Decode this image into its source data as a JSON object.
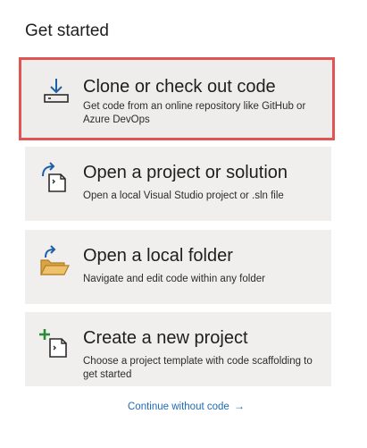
{
  "heading": "Get started",
  "cards": [
    {
      "title": "Clone or check out code",
      "description": "Get code from an online repository like GitHub or Azure DevOps",
      "icon": "download-clone-icon"
    },
    {
      "title": "Open a project or solution",
      "description": "Open a local Visual Studio project or .sln file",
      "icon": "open-project-icon"
    },
    {
      "title": "Open a local folder",
      "description": "Navigate and edit code within any folder",
      "icon": "open-folder-icon"
    },
    {
      "title": "Create a new project",
      "description": "Choose a project template with code scaffolding to get started",
      "icon": "new-project-icon"
    }
  ],
  "continue_link": {
    "label": "Continue without code",
    "arrow": "→"
  },
  "colors": {
    "highlight_border": "#e15453",
    "card_background": "#f0efee",
    "link": "#1f6bb5",
    "icon_blue": "#1f5fa8",
    "folder_tan": "#d9a441",
    "plus_green": "#2e8b3a"
  }
}
